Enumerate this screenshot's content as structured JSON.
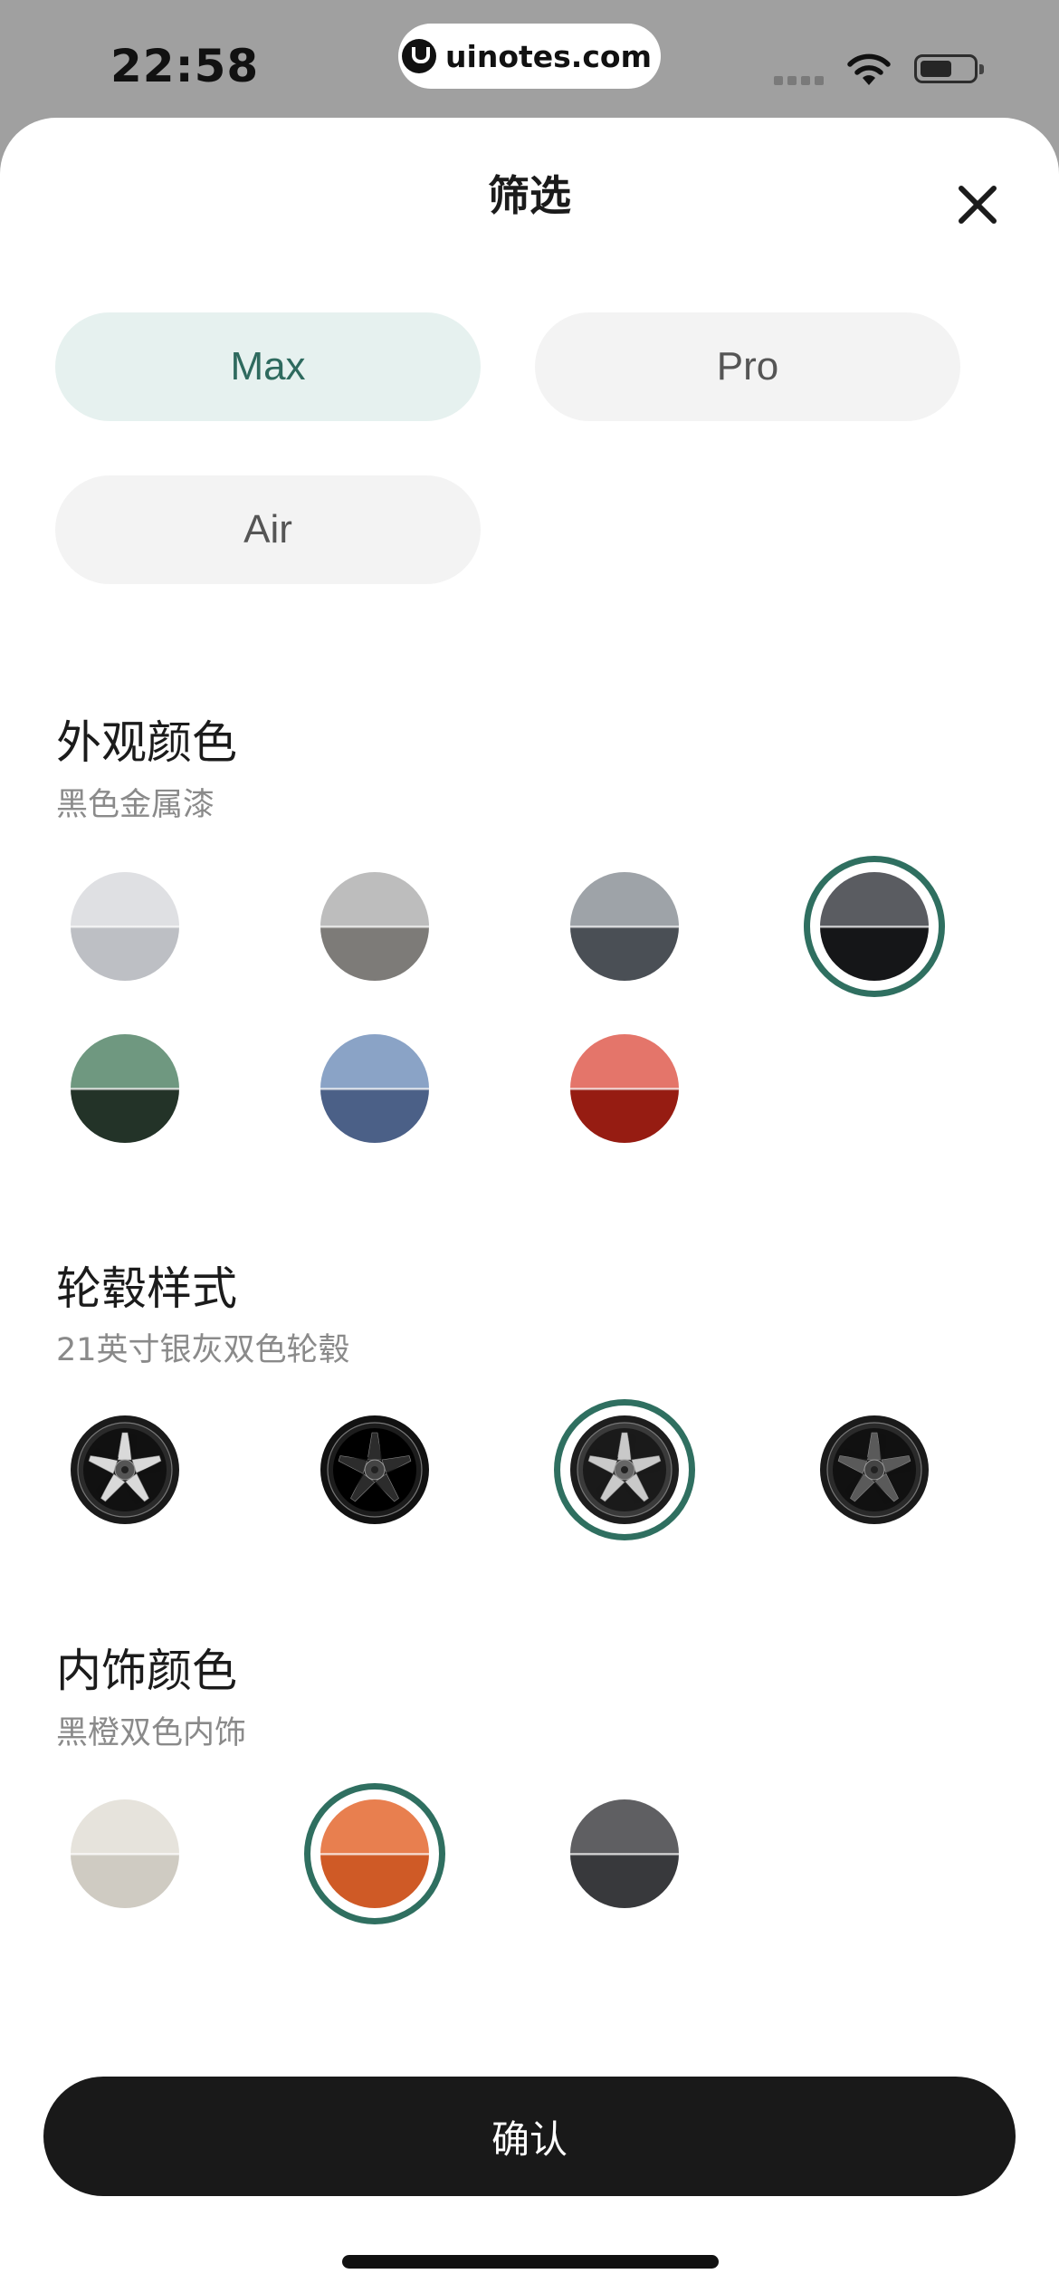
{
  "status_bar": {
    "time": "22:58",
    "url": "uinotes.com"
  },
  "sheet": {
    "title": "筛选",
    "trims": [
      {
        "label": "Max",
        "active": true
      },
      {
        "label": "Pro",
        "active": false
      },
      {
        "label": "Air",
        "active": false
      }
    ],
    "exterior": {
      "title": "外观颜色",
      "selected_name": "黑色金属漆",
      "swatches": [
        {
          "top": "#dfe0e3",
          "bottom": "#bdbfc4",
          "selected": false
        },
        {
          "top": "#bdbdbd",
          "bottom": "#7d7b78",
          "selected": false
        },
        {
          "top": "#9ea3a8",
          "bottom": "#4a4f55",
          "selected": false
        },
        {
          "top": "#5a5c61",
          "bottom": "#151618",
          "selected": true
        },
        {
          "top": "#6f9880",
          "bottom": "#233328",
          "selected": false
        },
        {
          "top": "#8aa3c6",
          "bottom": "#4b6087",
          "selected": false
        },
        {
          "top": "#e4756a",
          "bottom": "#961c12",
          "selected": false
        }
      ]
    },
    "wheels": {
      "title": "轮毂样式",
      "selected_name": "21英寸银灰双色轮毂",
      "items": [
        {
          "style": "silver-black",
          "selected": false
        },
        {
          "style": "all-black",
          "selected": false
        },
        {
          "style": "silver-grey",
          "selected": true
        },
        {
          "style": "dark-grey",
          "selected": false
        }
      ]
    },
    "interior": {
      "title": "内饰颜色",
      "selected_name": "黑橙双色内饰",
      "swatches": [
        {
          "top": "#e6e3dc",
          "bottom": "#cfcbc2",
          "selected": false
        },
        {
          "top": "#e87f4f",
          "bottom": "#cf5a26",
          "selected": true
        },
        {
          "top": "#5f5f62",
          "bottom": "#38393c",
          "selected": false
        }
      ]
    },
    "confirm_label": "确认"
  },
  "colors": {
    "accent": "#2f6f60",
    "active_pill_bg": "#e6f1ef",
    "inactive_pill_bg": "#f3f3f3",
    "confirm_bg": "#191919"
  },
  "icons": {
    "close": "close-icon",
    "wifi": "wifi-icon",
    "battery": "battery-icon"
  }
}
